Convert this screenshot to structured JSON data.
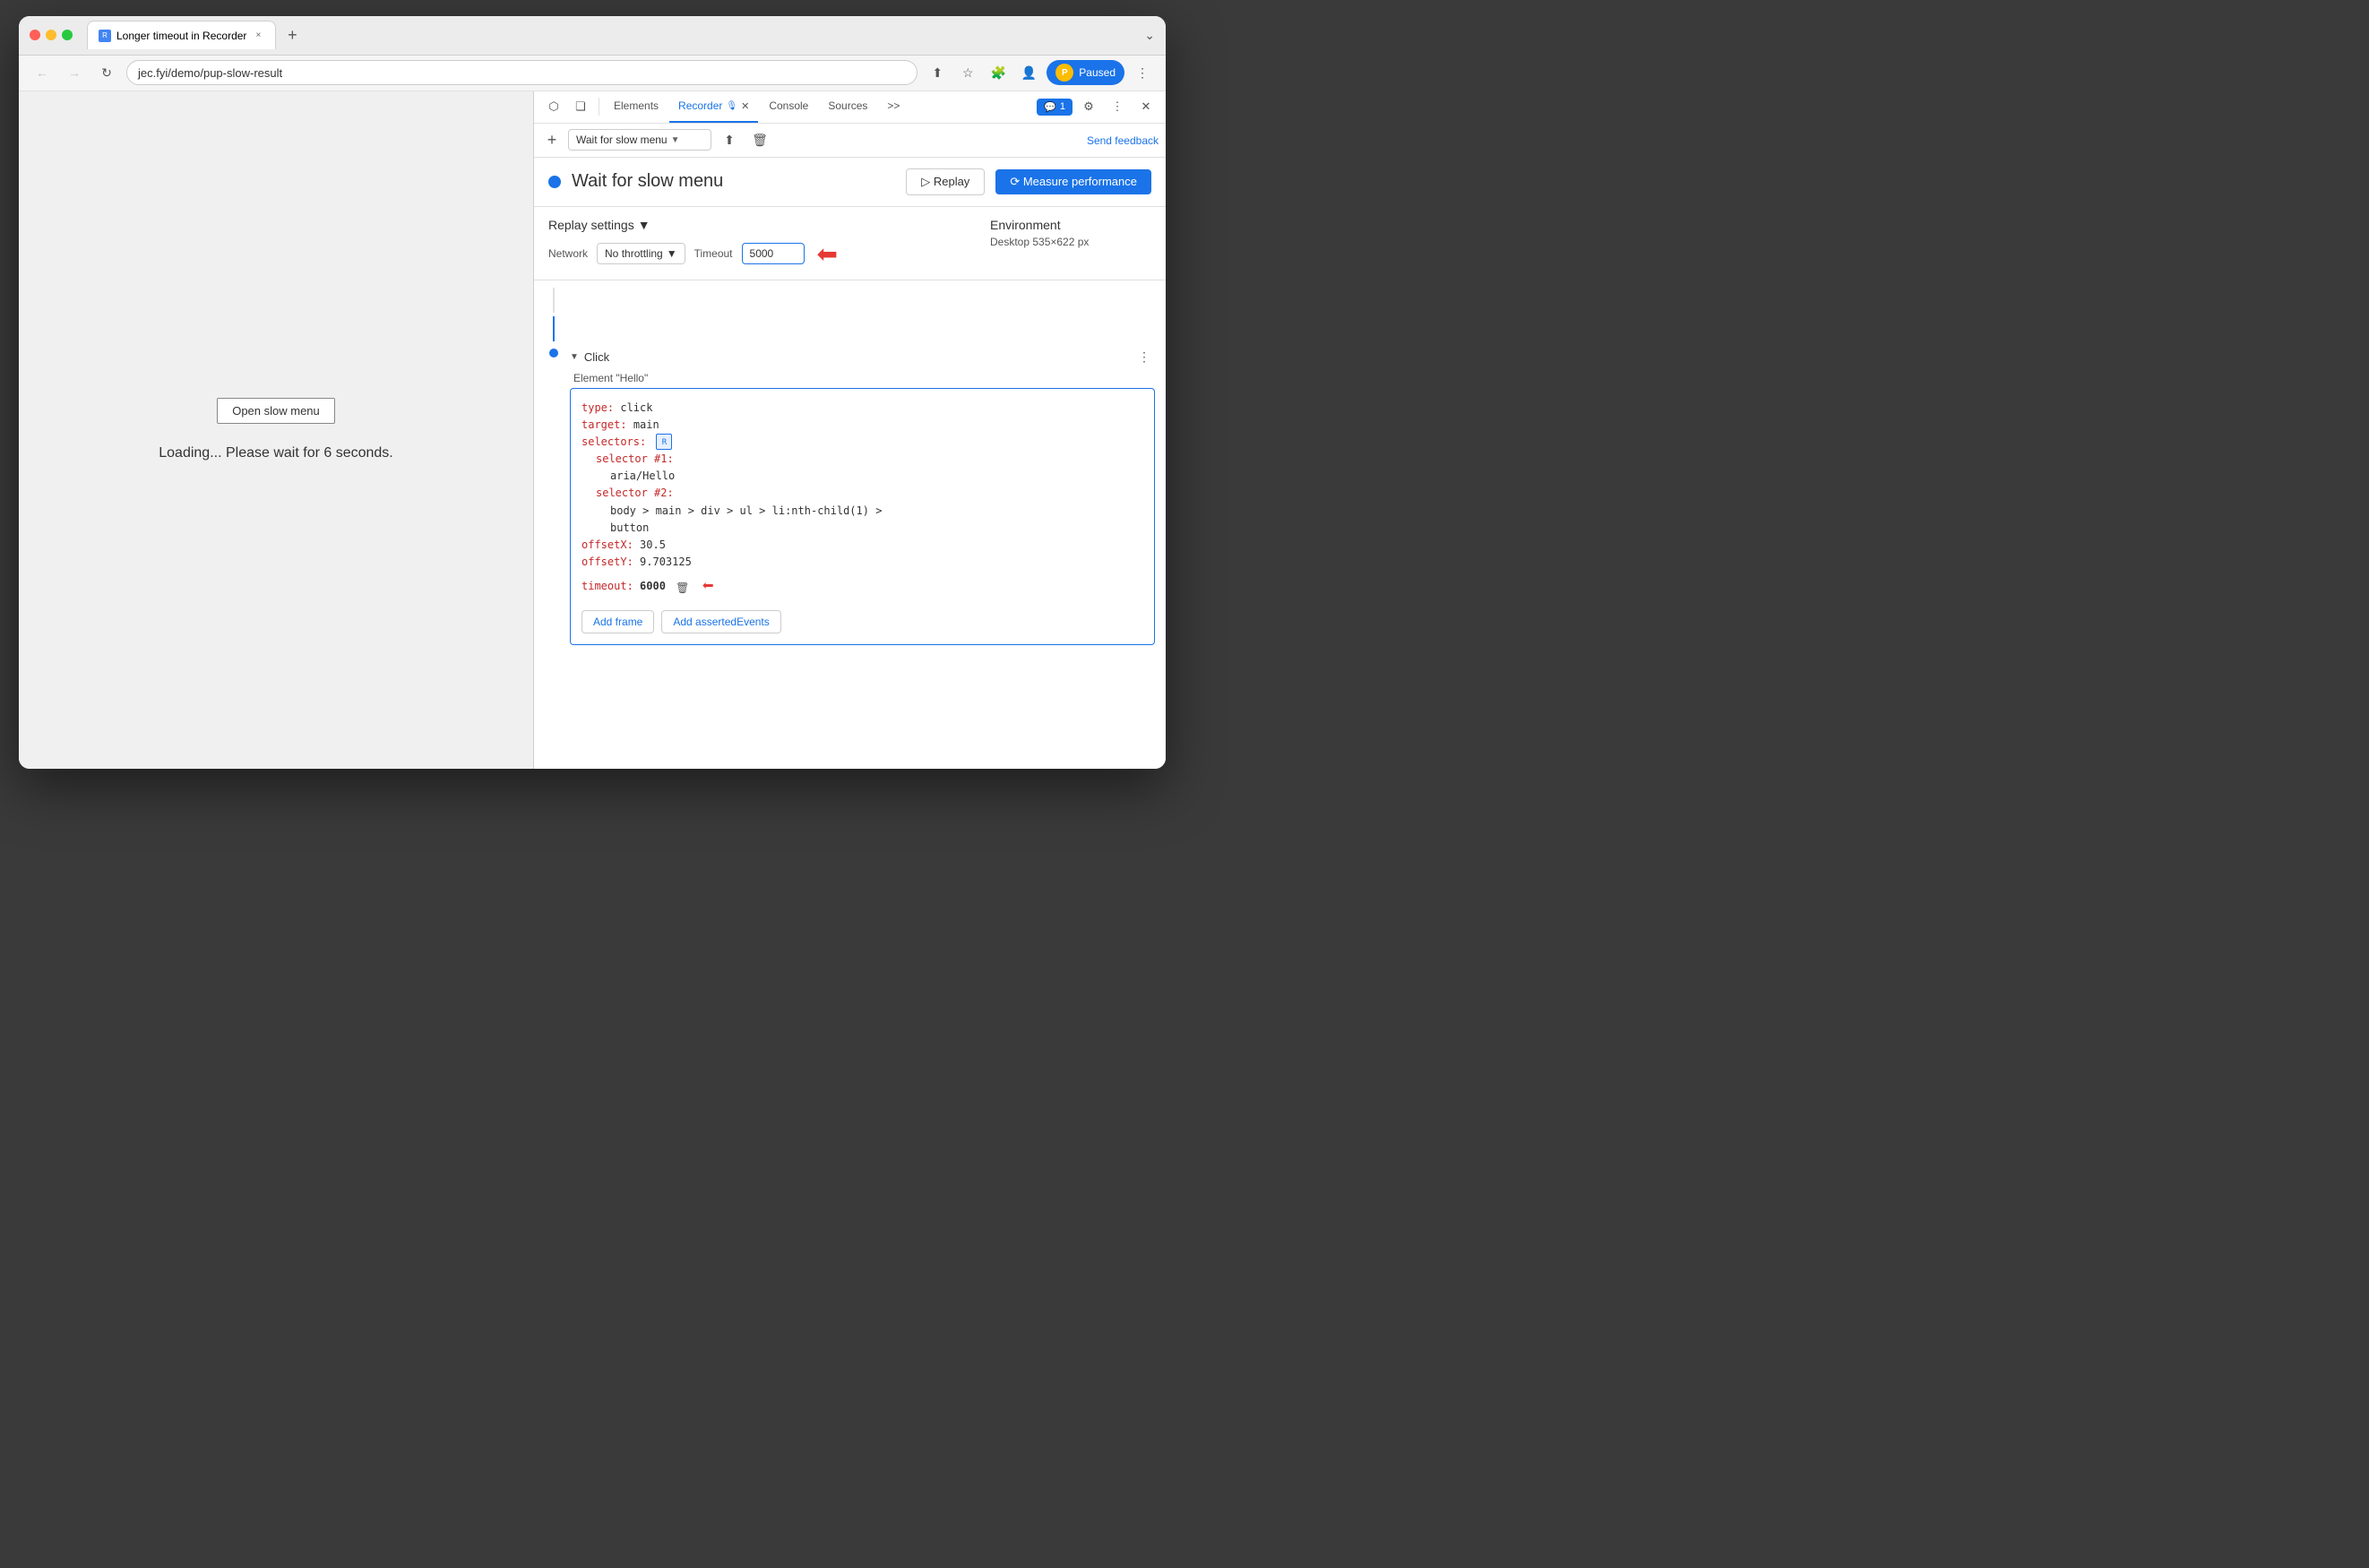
{
  "browser": {
    "title": "Longer timeout in Recorder",
    "tab_close": "×",
    "new_tab": "+",
    "url": "jec.fyi/demo/pup-slow-result",
    "nav_back": "←",
    "nav_forward": "→",
    "nav_refresh": "↻",
    "chevron_down": "⌄",
    "profile_label": "Paused",
    "more_btn": "⋮"
  },
  "page": {
    "open_slow_menu_btn": "Open slow menu",
    "loading_text": "Loading... Please wait for 6 seconds."
  },
  "devtools": {
    "tabs": {
      "elements": "Elements",
      "recorder": "Recorder",
      "console": "Console",
      "sources": "Sources",
      "more": ">>"
    },
    "toolbar_icons": {
      "cursor": "⬡",
      "layers": "❏",
      "chat": "💬 1",
      "settings": "⚙",
      "more": "⋮",
      "close": "✕"
    }
  },
  "recorder": {
    "add_btn": "+",
    "dropdown_label": "Wait for slow menu",
    "send_feedback": "Send feedback",
    "recording_title": "Wait for slow menu",
    "replay_btn": "▷  Replay",
    "measure_perf_btn": "⟳  Measure performance"
  },
  "replay_settings": {
    "title": "Replay settings",
    "network_label": "Network",
    "no_throttling": "No throttling",
    "timeout_label": "Timeout",
    "timeout_value": "5000",
    "env_title": "Environment",
    "env_value": "Desktop  535×622 px"
  },
  "step": {
    "step_name": "Click",
    "step_subtitle": "Element \"Hello\"",
    "more_btn": "⋮",
    "code": {
      "type_key": "type:",
      "type_val": " click",
      "target_key": "target:",
      "target_val": " main",
      "selectors_key": "selectors:",
      "selector1_key": "selector #1:",
      "selector1_val": "aria/Hello",
      "selector2_key": "selector #2:",
      "selector2_val": "body > main > div > ul > li:nth-child(1) >",
      "selector2_val2": "button",
      "offsetX_key": "offsetX:",
      "offsetX_val": " 30.5",
      "offsetY_key": "offsetY:",
      "offsetY_val": " 9.703125",
      "timeout_key": "timeout:",
      "timeout_val": " 6000"
    },
    "add_frame_btn": "Add frame",
    "add_asserted_btn": "Add assertedEvents"
  }
}
